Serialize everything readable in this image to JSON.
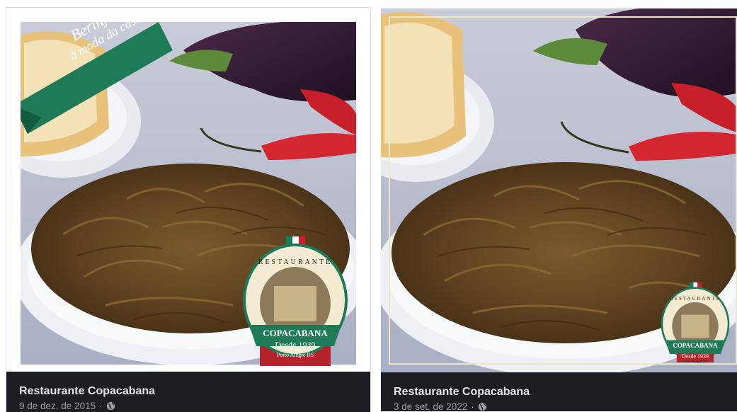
{
  "posts": [
    {
      "author": "Restaurante Copacabana",
      "date": "9 de dez. de 2015",
      "separator": "·",
      "privacy_icon": "globe-icon",
      "photo": {
        "banner_line1": "Berinjela",
        "banner_line2": "à moda da casa",
        "logo_top": "RESTAURANTE",
        "logo_name": "COPACABANA",
        "logo_since": "Desde 1939",
        "logo_city": "Porto Alegre RS"
      }
    },
    {
      "author": "Restaurante Copacabana",
      "date": "3 de set. de 2022",
      "separator": "·",
      "privacy_icon": "globe-icon",
      "photo": {
        "logo_top": "RESTAURANTE",
        "logo_name": "COPACABANA",
        "logo_since": "Desde 1939",
        "logo_city": "Porto Alegre RS"
      }
    }
  ],
  "colors": {
    "banner_green": "#1e7a57",
    "footer_bg": "#1c1e21",
    "logo_red": "#b3242c",
    "food_brown": "#6b4a22"
  }
}
